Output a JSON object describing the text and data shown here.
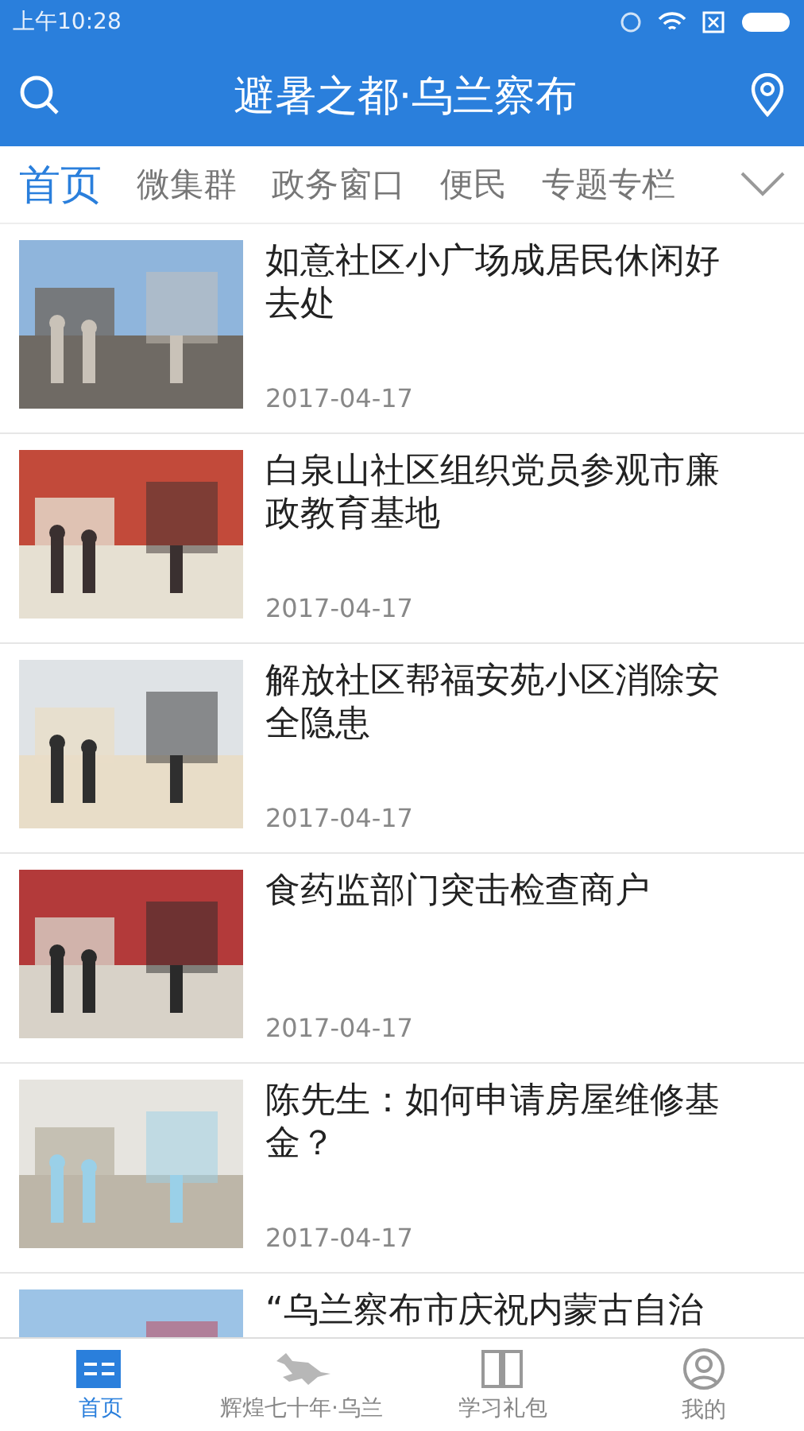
{
  "status_bar": {
    "time": "上午10:28"
  },
  "header": {
    "title": "避暑之都·乌兰察布"
  },
  "tabs": [
    {
      "label": "首页",
      "selected": true
    },
    {
      "label": "微集群",
      "selected": false
    },
    {
      "label": "政务窗口",
      "selected": false
    },
    {
      "label": "便民",
      "selected": false
    },
    {
      "label": "专题专栏",
      "selected": false
    }
  ],
  "articles": [
    {
      "title": "如意社区小广场成居民休闲好去处",
      "date": "2017-04-17"
    },
    {
      "title": "白泉山社区组织党员参观市廉政教育基地",
      "date": "2017-04-17"
    },
    {
      "title": "解放社区帮福安苑小区消除安全隐患",
      "date": "2017-04-17"
    },
    {
      "title": "食药监部门突击检查商户",
      "date": "2017-04-17"
    },
    {
      "title": "陈先生：如何申请房屋维修基金？",
      "date": "2017-04-17"
    },
    {
      "title": "“乌兰察布市庆祝内蒙古自治"
    }
  ],
  "bottom_nav": [
    {
      "label": "首页",
      "selected": true
    },
    {
      "label": "辉煌七十年·乌兰",
      "selected": false
    },
    {
      "label": "学习礼包",
      "selected": false
    },
    {
      "label": "我的",
      "selected": false
    }
  ]
}
